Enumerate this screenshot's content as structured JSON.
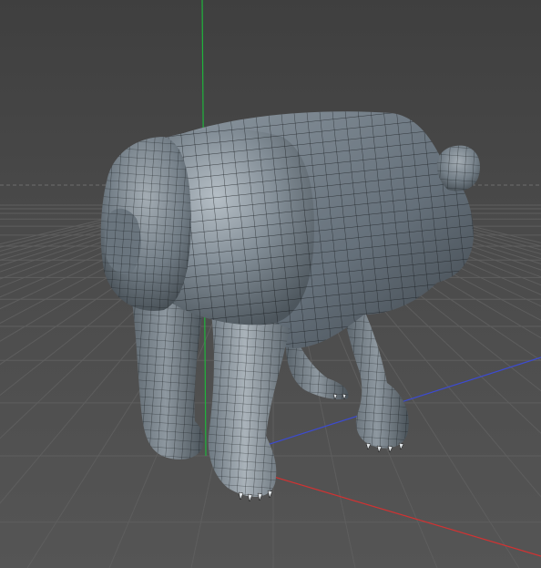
{
  "viewport": {
    "name": "perspective-viewport",
    "background": "#4b4b4b",
    "floor_grid": true,
    "horizon_dashed": true
  },
  "axes": {
    "y_color": "#1fb43c",
    "x_color": "#d23232",
    "z_color": "#3c4bd2"
  },
  "model": {
    "name": "bear-mesh",
    "display": "gouraud-shading-lines",
    "base_color": "#7f8a93",
    "wire_color": "#0e1114"
  }
}
